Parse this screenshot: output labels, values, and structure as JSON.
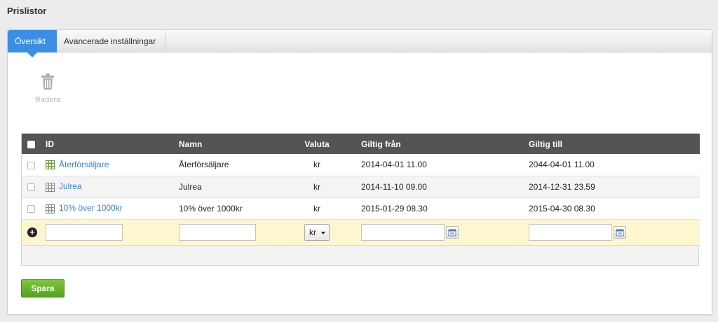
{
  "page": {
    "title": "Prislistor"
  },
  "tabs": [
    {
      "label": "Översikt",
      "active": true
    },
    {
      "label": "Avancerade inställningar",
      "active": false
    }
  ],
  "toolbar": {
    "delete_label": "Radera",
    "delete_icon": "trash-icon"
  },
  "table": {
    "columns": {
      "id": "ID",
      "name": "Namn",
      "currency": "Valuta",
      "valid_from": "Giltig från",
      "valid_to": "Giltig till"
    },
    "rows": [
      {
        "id": "Återförsäljare",
        "name": "Återförsäljare",
        "currency": "kr",
        "valid_from": "2014-04-01 11.00",
        "valid_to": "2044-04-01 11.00",
        "icon": "grid-green-icon"
      },
      {
        "id": "Julrea",
        "name": "Julrea",
        "currency": "kr",
        "valid_from": "2014-11-10 09.00",
        "valid_to": "2014-12-31 23.59",
        "icon": "grid-gray-icon"
      },
      {
        "id": "10% över 1000kr",
        "name": "10% över 1000kr",
        "currency": "kr",
        "valid_from": "2015-01-29 08.30",
        "valid_to": "2015-04-30 08.30",
        "icon": "grid-gray-icon"
      }
    ],
    "new_row": {
      "id_value": "",
      "name_value": "",
      "currency_selected": "kr",
      "valid_from_value": "",
      "valid_to_value": ""
    }
  },
  "actions": {
    "save_label": "Spara"
  },
  "colors": {
    "accent": "#3b8ee4",
    "header_bg": "#545454",
    "save_green": "#5aab1f",
    "new_row_bg": "#fdf6cf",
    "link": "#3b82d6"
  }
}
